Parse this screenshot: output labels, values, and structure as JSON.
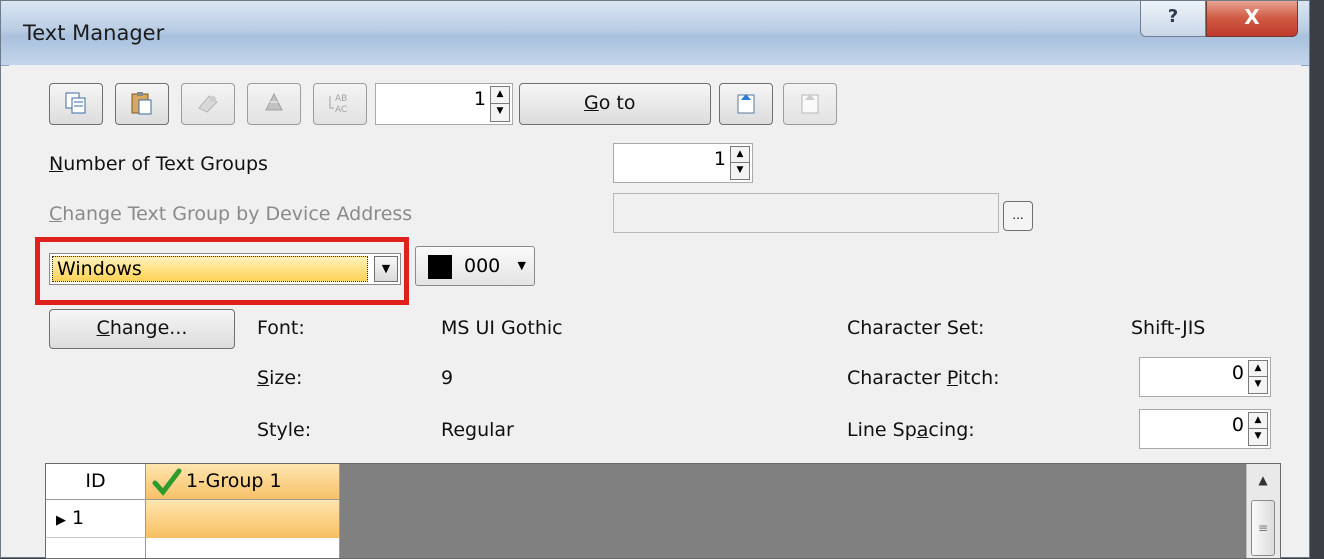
{
  "window": {
    "title": "Text Manager",
    "help_glyph": "?",
    "close_glyph": "X"
  },
  "toolbar": {
    "icons": [
      "copy-icon",
      "paste-icon",
      "clear-icon",
      "import-icon",
      "replace-text-icon",
      "export-icon",
      "import-file-icon"
    ],
    "group_spin_value": "1",
    "goto_label_u": "G",
    "goto_label_rest": "o to"
  },
  "settings": {
    "num_groups_label_u": "N",
    "num_groups_label_rest": "umber of Text Groups",
    "num_groups_value": "1",
    "device_addr_label_u": "C",
    "device_addr_label_rest": "hange Text Group by Device Address",
    "device_addr_value": "",
    "browse_label": "..."
  },
  "font_source": {
    "selected": "Windows"
  },
  "color": {
    "swatch": "#000000",
    "code": "000"
  },
  "font": {
    "change_label_u": "C",
    "change_label_rest": "hange...",
    "font_label": "Font:",
    "font_value": "MS UI Gothic",
    "size_label_u": "S",
    "size_label_rest": "ize:",
    "size_value": "9",
    "style_label": "Style:",
    "style_value": "Regular",
    "charset_label": "Character Set:",
    "charset_value": "Shift-JIS",
    "pitch_label_a": "Character ",
    "pitch_label_u": "P",
    "pitch_label_b": "itch:",
    "pitch_value": "0",
    "spacing_label_a": "Line Sp",
    "spacing_label_u": "a",
    "spacing_label_b": "cing:",
    "spacing_value": "0"
  },
  "grid": {
    "columns": [
      "ID",
      "1-Group 1"
    ],
    "rows": [
      {
        "id": "1",
        "text": ""
      }
    ],
    "row_marker": "▶"
  },
  "colors": {
    "highlight": "#e0201a",
    "selection": "#ffd256",
    "header_active": "#f7c168"
  }
}
